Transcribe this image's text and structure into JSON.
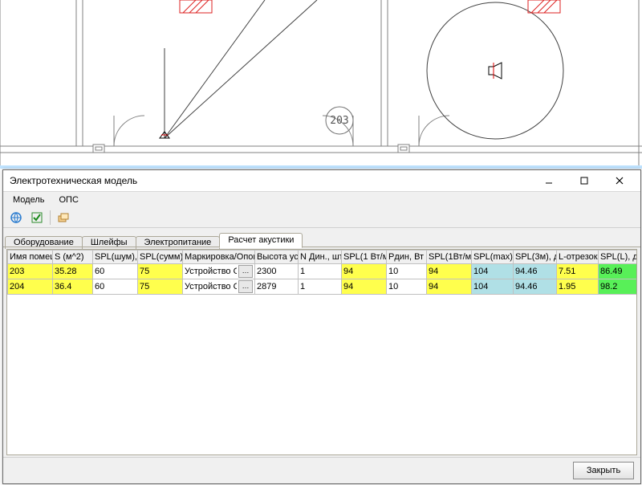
{
  "dialog": {
    "title": "Электротехническая модель"
  },
  "menu": {
    "model": "Модель",
    "ops": "ОПС"
  },
  "tabs": {
    "equipment": "Оборудование",
    "loops": "Шлейфы",
    "power": "Электропитание",
    "acoustics": "Расчет акустики"
  },
  "columns": {
    "c0": "Имя помещ",
    "c1": "S (м^2)",
    "c2": "SPL(шум), ",
    "c3": "SPL(сумм), ",
    "c4": "Маркировка/Опов",
    "c5": "Высота уст",
    "c6": "N Дин., шт",
    "c7": "SPL(1 Вт/м",
    "c8": "Pдин, Вт",
    "c9": "SPL(1Вт/м,",
    "c10": "SPL(max), ",
    "c11": "SPL(3м), д",
    "c12": "L-отрезок,",
    "c13": "SPL(L), дБ"
  },
  "rows": [
    {
      "room": "203",
      "S": "35.28",
      "spl_noise": "60",
      "spl_sum": "75",
      "marking": "Устройство ОПС",
      "height": "2300",
      "N": "1",
      "spl1": "94",
      "P": "10",
      "spl1b": "94",
      "splmax": "104",
      "spl3": "94.46",
      "L": "7.51",
      "splL": "86.49"
    },
    {
      "room": "204",
      "S": "36.4",
      "spl_noise": "60",
      "spl_sum": "75",
      "marking": "Устройство ОПС",
      "height": "2879",
      "N": "1",
      "spl1": "94",
      "P": "10",
      "spl1b": "94",
      "splmax": "104",
      "spl3": "94.46",
      "L": "1.95",
      "splL": "98.2"
    }
  ],
  "schematic": {
    "room_label": "203"
  },
  "buttons": {
    "close": "Закрыть"
  }
}
